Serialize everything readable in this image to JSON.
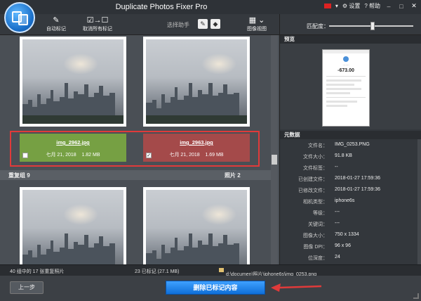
{
  "window": {
    "title": "Duplicate Photos Fixer Pro",
    "settings_label": "设置",
    "help_label": "帮助"
  },
  "toolbar": {
    "auto_mark": "自动标记",
    "unmark_all": "取消所有标记",
    "assistant": "选择助手",
    "image_view": "图像视图"
  },
  "match": {
    "label": "匹配度：",
    "level": 0.52
  },
  "group_top": {
    "items": [
      {
        "filename": "img_2962.jpg",
        "date": "七月 21, 2018",
        "size": "1.82 MB",
        "checked": false,
        "status_color": "#76a043"
      },
      {
        "filename": "img_2963.jpg",
        "date": "七月 21, 2018",
        "size": "1.69 MB",
        "checked": true,
        "status_color": "#a44a4a"
      }
    ]
  },
  "group_bar": {
    "name": "重复组 9",
    "count": "照片 2"
  },
  "preview": {
    "title": "预览",
    "amount": "-673.00"
  },
  "metadata": {
    "title": "元数据",
    "rows": [
      {
        "key": "文件名：",
        "value": "IMG_0253.PNG"
      },
      {
        "key": "文件大小：",
        "value": "91.8 KB"
      },
      {
        "key": "文件标签：",
        "value": "--"
      },
      {
        "key": "已创建文件：",
        "value": "2018-01-27 17:59:36"
      },
      {
        "key": "已修改文件：",
        "value": "2018-01-27 17:59:36"
      },
      {
        "key": "相机类型：",
        "value": "iphone6s"
      },
      {
        "key": "等级：",
        "value": "---"
      },
      {
        "key": "关键词：",
        "value": "---"
      },
      {
        "key": "图像大小：",
        "value": "750 x 1334"
      },
      {
        "key": "图像 DPI：",
        "value": "96 x 96"
      },
      {
        "key": "位深度：",
        "value": "24"
      },
      {
        "key": "方向：",
        "value": "---"
      }
    ]
  },
  "status": {
    "groups_text": "40 组中的 17 张重复照片",
    "marked_text": "23 已标记 (27.1 MB)",
    "path_text": "d:\\documen\\照片\\iphone6s\\img_0253.png"
  },
  "bottom": {
    "back_label": "上一步",
    "delete_label": "删除已标记内容"
  },
  "icons": {
    "app": "duplicate-photos-logo",
    "auto_mark": "magic-wand-icon",
    "unmark": "checkbox-arrow-icon",
    "image_view": "grid-view-icon"
  },
  "colors": {
    "accent": "#1a7ee6",
    "highlight": "#e03a3a"
  }
}
